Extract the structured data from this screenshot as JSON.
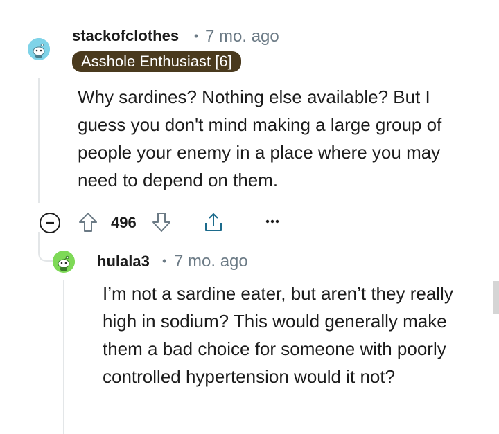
{
  "comment": {
    "username": "stackofclothes",
    "separator": "•",
    "time": "7 mo. ago",
    "flair": "Asshole Enthusiast [6]",
    "body": "Why sardines? Nothing else available? But I guess you don't mind making a large group of people your enemy in a place where you may need to depend on them.",
    "score": "496",
    "avatar_color": "#7fd3e8"
  },
  "reply": {
    "username": "hulala3",
    "separator": "•",
    "time": "7 mo. ago",
    "body": "I’m not a sardine eater, but aren’t they really high in sodium? This would generally make them a bad choice for someone with poorly controlled hypertension would it not?",
    "avatar_color": "#7ed957"
  },
  "icons": {
    "collapse": "minus-circle-icon",
    "upvote": "arrow-up-icon",
    "downvote": "arrow-down-icon",
    "share": "share-icon",
    "more": "more-icon"
  }
}
